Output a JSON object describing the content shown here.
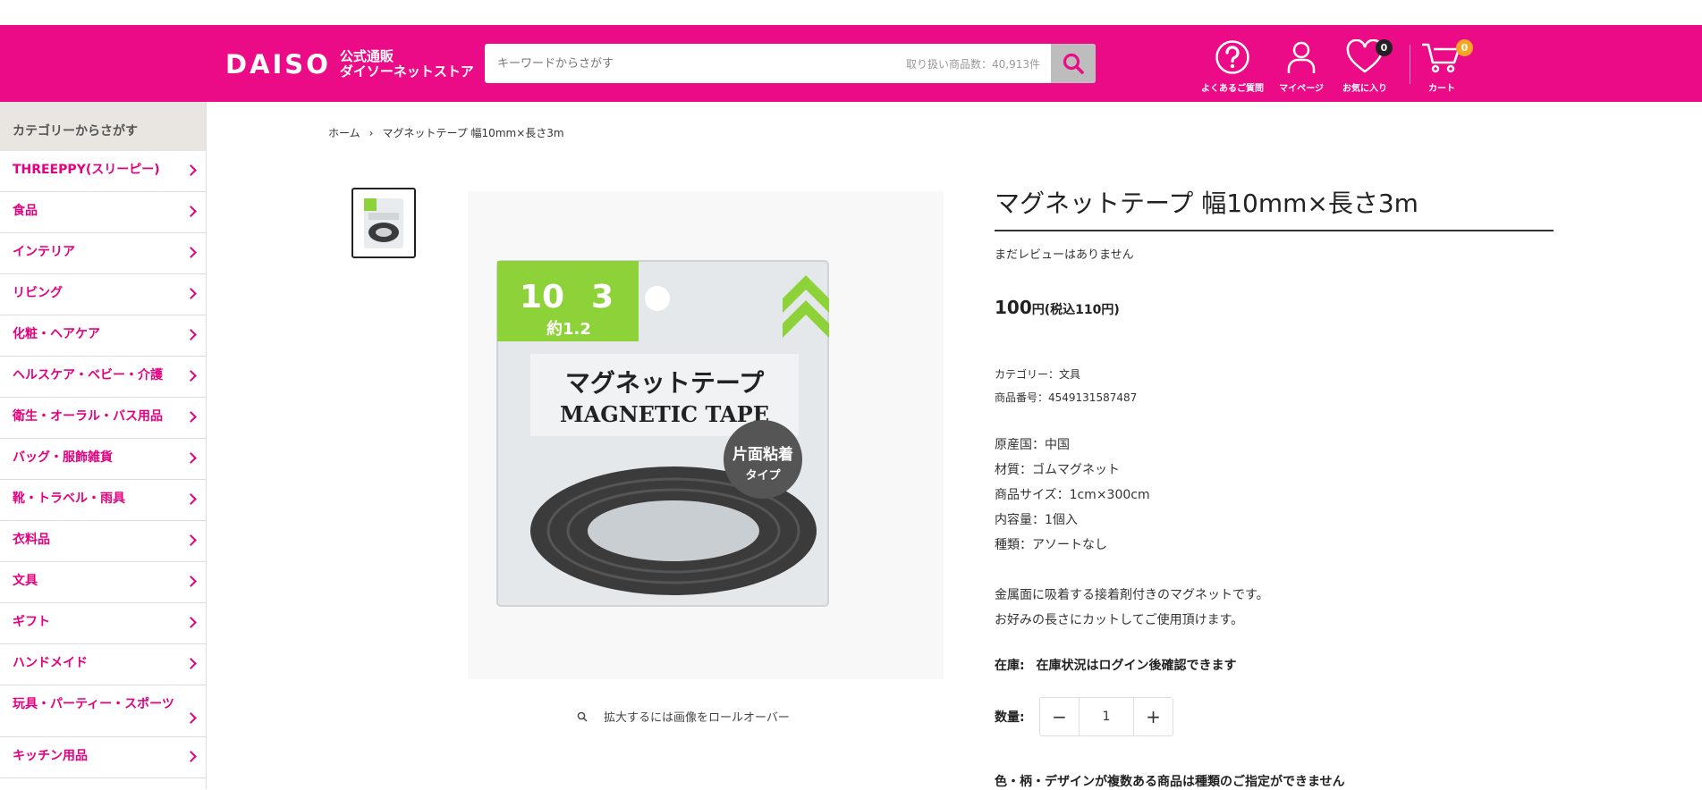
{
  "header": {
    "logo_main": "DAISO",
    "logo_sub_1": "公式通販",
    "logo_sub_2": "ダイソーネットストア",
    "search_placeholder": "キーワードからさがす",
    "search_count": "取り扱い商品数：40,913件",
    "faq_label": "よくあるご質問",
    "mypage_label": "マイページ",
    "favorites_label": "お気に入り",
    "favorites_count": "0",
    "cart_label": "カート",
    "cart_count": "0",
    "brand_color": "#ec0b86"
  },
  "sidebar": {
    "heading": "カテゴリーからさがす",
    "items": [
      {
        "label": "THREEPPY(スリーピー)"
      },
      {
        "label": "食品"
      },
      {
        "label": "インテリア"
      },
      {
        "label": "リビング"
      },
      {
        "label": "化粧・ヘアケア"
      },
      {
        "label": "ヘルスケア・ベビー・介護"
      },
      {
        "label": "衛生・オーラル・バス用品"
      },
      {
        "label": "バッグ・服飾雑貨"
      },
      {
        "label": "靴・トラベル・雨具"
      },
      {
        "label": "衣料品"
      },
      {
        "label": "文具"
      },
      {
        "label": "ギフト"
      },
      {
        "label": "ハンドメイド"
      },
      {
        "label": "玩具・パーティー・スポーツ"
      },
      {
        "label": "キッチン用品"
      }
    ]
  },
  "breadcrumb": {
    "home": "ホーム",
    "current": "マグネットテープ 幅10mm×長さ3m"
  },
  "gallery": {
    "zoom_hint": "拡大するには画像をロールオーバー",
    "package_title_jp": "マグネットテープ",
    "package_title_en": "MAGNETIC TAPE",
    "package_width": "10",
    "package_length": "3",
    "package_thickness": "約1.2",
    "package_badge": "片面粘着",
    "package_badge_sub": "タイプ"
  },
  "product": {
    "title": "マグネットテープ 幅10mm×長さ3m",
    "review": "まだレビューはありません",
    "price": "100",
    "price_unit": "円(税込110円)",
    "category": "カテゴリー：文具",
    "sku": "商品番号：4549131587487",
    "specs": [
      "原産国：中国",
      "材質：ゴムマグネット",
      "商品サイズ：1cm×300cm",
      "内容量：1個入",
      "種類：アソートなし"
    ],
    "description": [
      "金属面に吸着する接着剤付きのマグネットです。",
      "お好みの長さにカットしてご使用頂けます。"
    ],
    "stock_label": "在庫:",
    "stock_value": "在庫状況はログイン後確認できます",
    "qty_label": "数量:",
    "qty_value": "1",
    "variant_note": "色・柄・デザインが複数ある商品は種類のご指定ができません"
  }
}
